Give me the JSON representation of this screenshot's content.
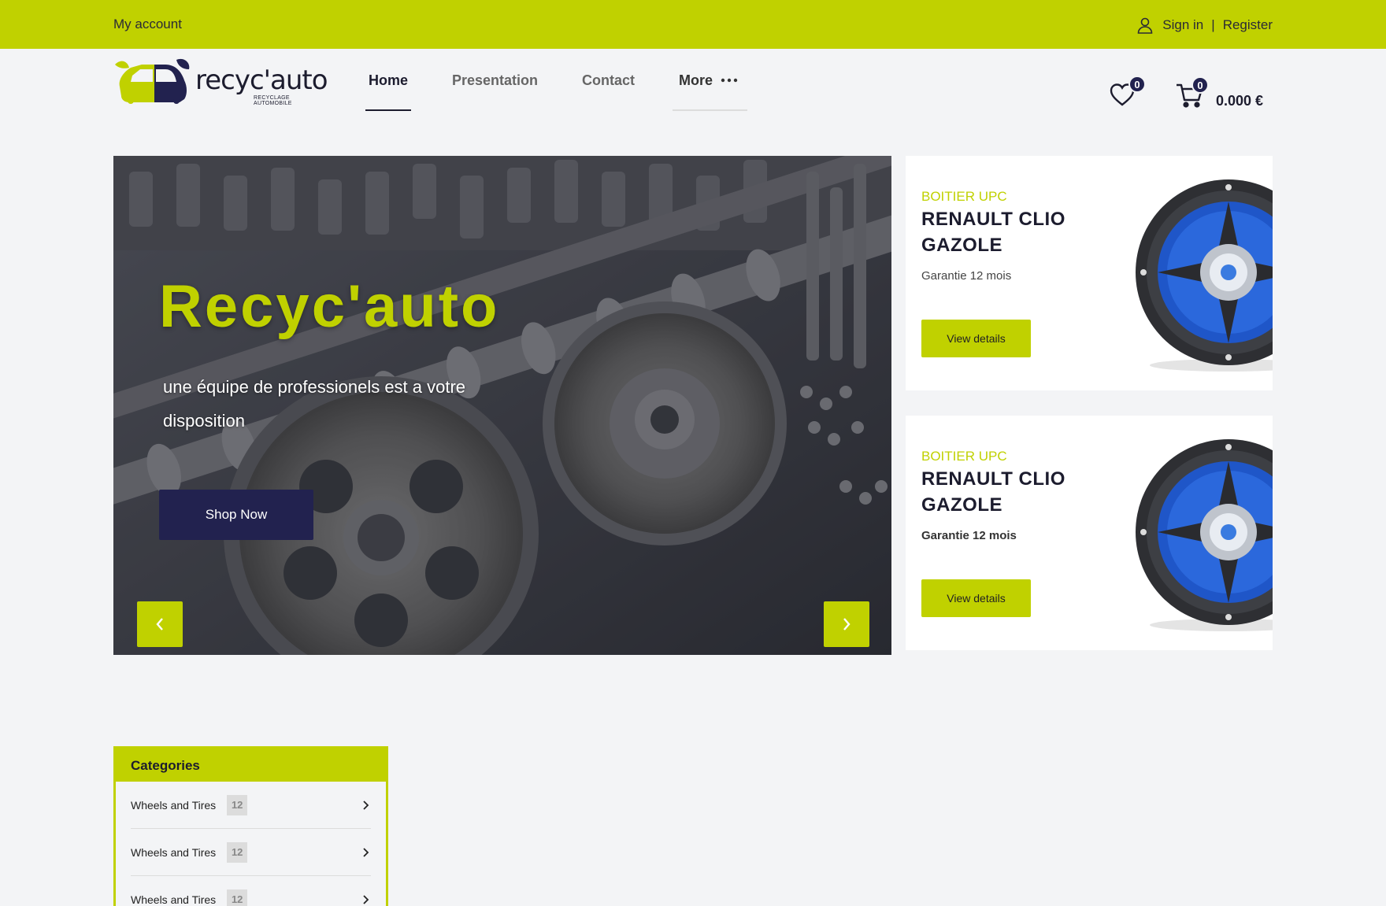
{
  "topbar": {
    "my_account": "My account",
    "sign_in": "Sign in",
    "separator": "|",
    "register": "Register",
    "background_color": "#c0d100"
  },
  "logo": {
    "text": "recyc'auto",
    "subtext": "RECYCLAGE AUTOMOBILE",
    "icon": "car-icon"
  },
  "nav": {
    "items": [
      {
        "label": "Home",
        "active": true
      },
      {
        "label": "Presentation",
        "active": false
      },
      {
        "label": "Contact",
        "active": false
      },
      {
        "label": "More",
        "active": false
      }
    ],
    "more_icon": "ellipsis-icon"
  },
  "header_actions": {
    "wishlist_count": "0",
    "cart_count": "0",
    "cart_total": "0.000 €",
    "wishlist_icon": "heart-icon",
    "cart_icon": "cart-icon"
  },
  "hero": {
    "title": "Recyc'auto",
    "subtitle": "une équipe de professionels est a votre disposition",
    "cta": "Shop Now",
    "prev_icon": "chevron-left-icon",
    "next_icon": "chevron-right-icon"
  },
  "promos": [
    {
      "kicker": "BOITIER UPC",
      "name": "RENAULT CLIO GAZOLE",
      "guarantee": "Garantie 12 mois",
      "button": "View details",
      "image": "car-speaker-image"
    },
    {
      "kicker": "BOITIER UPC",
      "name": "RENAULT CLIO GAZOLE",
      "guarantee": "Garantie 12 mois",
      "button": "View details",
      "image": "car-speaker-image"
    }
  ],
  "categories": {
    "title": "Categories",
    "items": [
      {
        "label": "Wheels and Tires",
        "count": "12"
      },
      {
        "label": "Wheels and Tires",
        "count": "12"
      },
      {
        "label": "Wheels and Tires",
        "count": "12"
      }
    ]
  },
  "colors": {
    "accent": "#c0d100",
    "navy": "#22224f",
    "page_bg": "#f3f4f6"
  }
}
